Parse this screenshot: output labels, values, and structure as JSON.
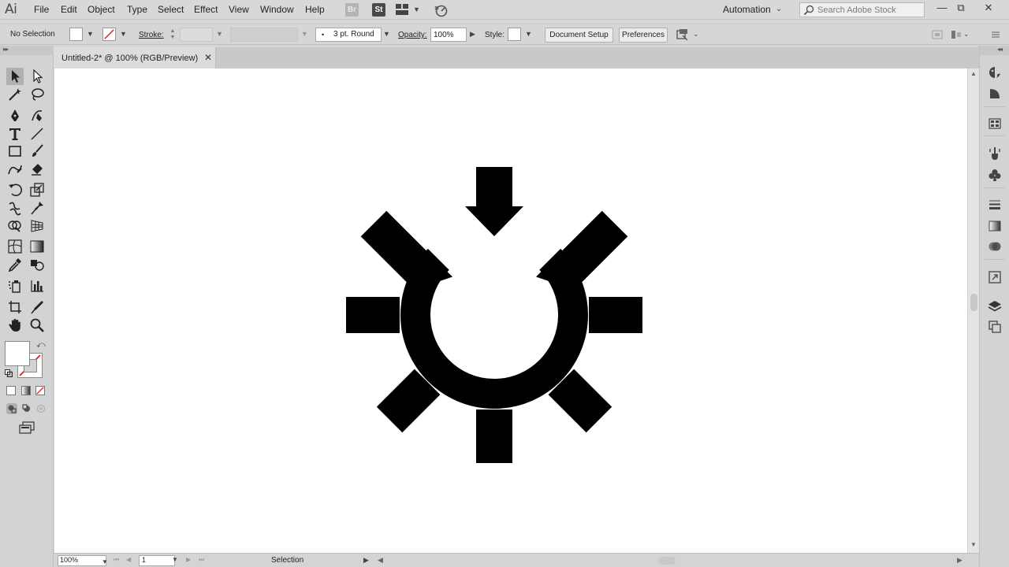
{
  "app": {
    "logo": "Ai",
    "menu": [
      "File",
      "Edit",
      "Object",
      "Type",
      "Select",
      "Effect",
      "View",
      "Window",
      "Help"
    ],
    "bridge_label": "Br",
    "stock_label": "St",
    "workspace": "Automation",
    "search_placeholder": "Search Adobe Stock",
    "window_controls": {
      "minimize": "—",
      "restore": "⧉",
      "close": "✕"
    }
  },
  "control_bar": {
    "selection_label": "No Selection",
    "stroke_label": "Stroke:",
    "brush_dot": "•",
    "brush_profile": "3 pt. Round",
    "opacity_label": "Opacity:",
    "opacity_value": "100%",
    "style_label": "Style:",
    "document_setup_label": "Document Setup",
    "preferences_label": "Preferences"
  },
  "document": {
    "tab_title": "Untitled-2* @ 100% (RGB/Preview)",
    "close_glyph": "✕"
  },
  "status_bar": {
    "zoom": "100%",
    "artboard": "1",
    "current_tool": "Selection"
  },
  "colors": {
    "chrome": "#d6d6d6",
    "canvas": "#ffffff",
    "artwork": "#000000",
    "none_slash": "#d81e1e"
  }
}
